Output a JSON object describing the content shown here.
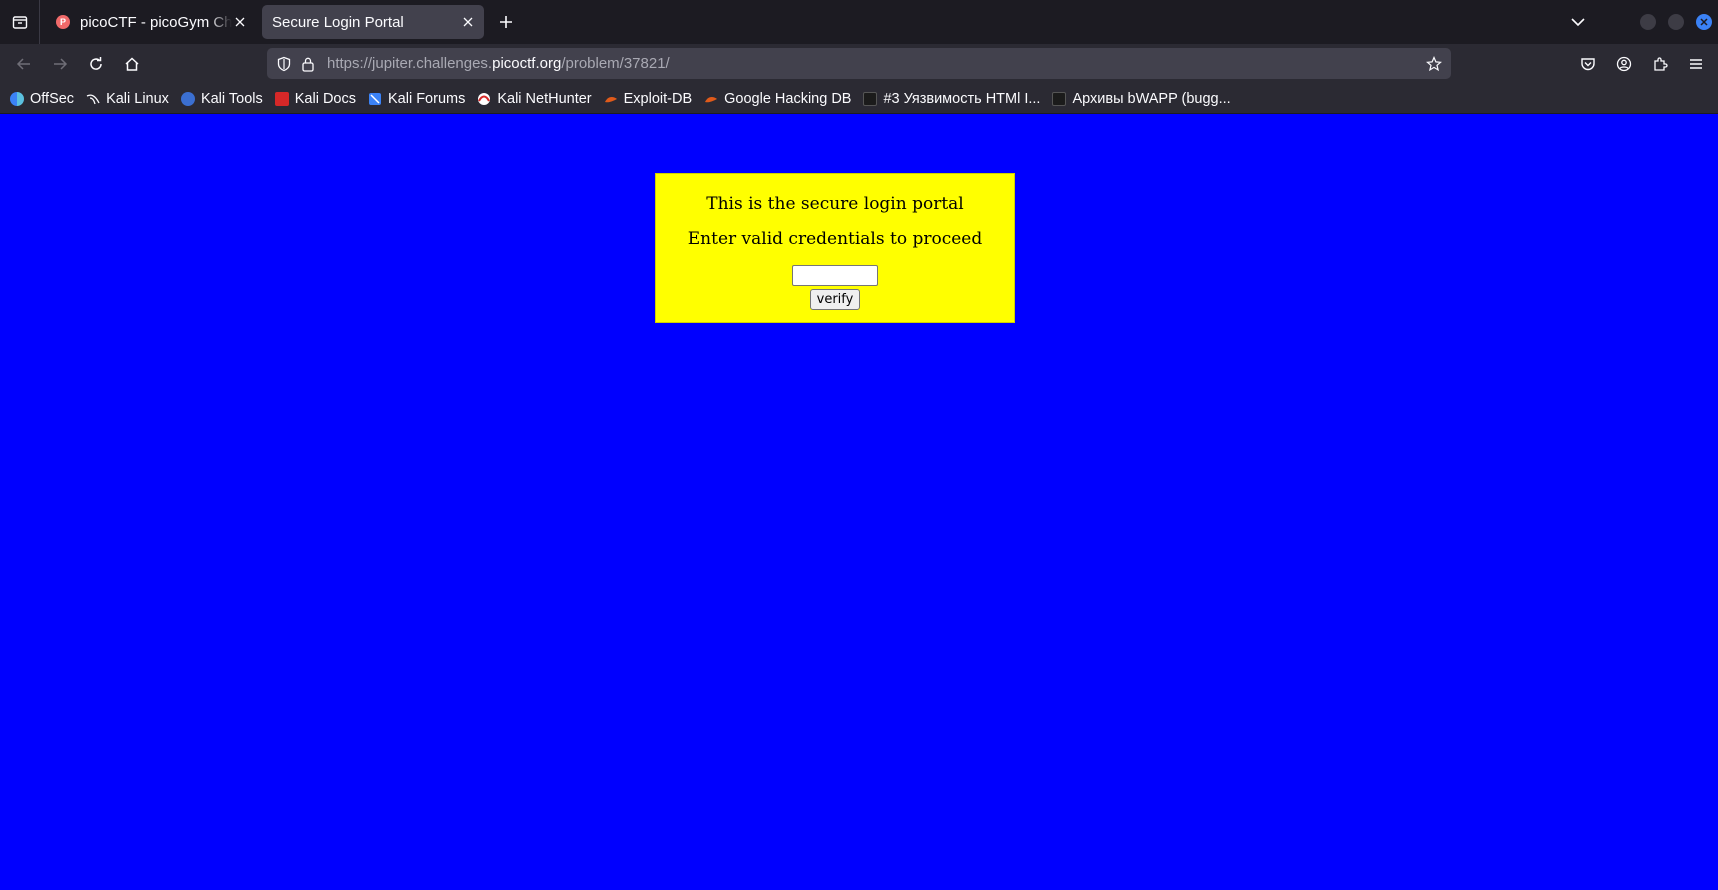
{
  "browser": {
    "tabs": [
      {
        "title": "picoCTF - picoGym Challenges",
        "favicon_letter": "P",
        "active": false
      },
      {
        "title": "Secure Login Portal",
        "active": true
      }
    ],
    "url": {
      "prefix": "https://jupiter.challenges.",
      "host": "picoctf.org",
      "path": "/problem/37821/"
    },
    "bookmarks": [
      {
        "label": "OffSec",
        "color": "#4a90d9"
      },
      {
        "label": "Kali Linux",
        "color": "#2b2a33"
      },
      {
        "label": "Kali Tools",
        "color": "#3b6fd1"
      },
      {
        "label": "Kali Docs",
        "color": "#d62828"
      },
      {
        "label": "Kali Forums",
        "color": "#3b82f6"
      },
      {
        "label": "Kali NetHunter",
        "color": "#d62828"
      },
      {
        "label": "Exploit-DB",
        "color": "#e05a1a"
      },
      {
        "label": "Google Hacking DB",
        "color": "#e05a1a"
      },
      {
        "label": "#3 Уязвимость HTMl I...",
        "color": "#1b1b1b"
      },
      {
        "label": "Архивы bWAPP (bugg...",
        "color": "#1b1b1b"
      }
    ],
    "accent_color": "#3b82f6"
  },
  "page": {
    "background_color": "#0000ff",
    "panel_color": "#ffff00",
    "line1": "This is the secure login portal",
    "line2": "Enter valid credentials to proceed",
    "input_value": "",
    "button_label": "verify"
  }
}
